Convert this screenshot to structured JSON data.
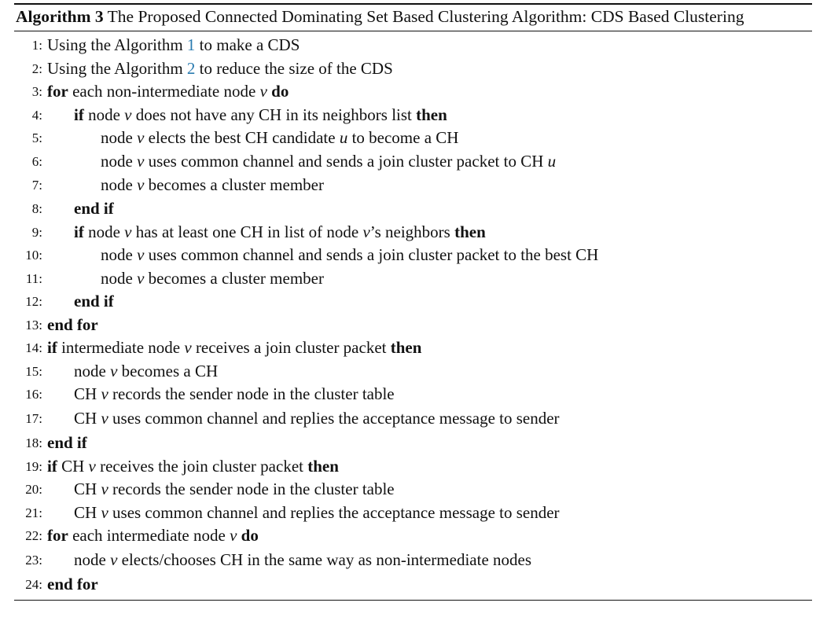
{
  "algorithm": {
    "label": "Algorithm 3",
    "caption": "The Proposed Connected Dominating Set Based Clustering Algorithm: CDS Based Clustering",
    "ref_color": "#2a7bb0",
    "lines": [
      {
        "num": "1:",
        "indent": 0,
        "parts": [
          {
            "t": "Using the Algorithm "
          },
          {
            "t": "1",
            "s": "ref"
          },
          {
            "t": " to make a CDS"
          }
        ]
      },
      {
        "num": "2:",
        "indent": 0,
        "parts": [
          {
            "t": "Using the Algorithm "
          },
          {
            "t": "2",
            "s": "ref"
          },
          {
            "t": " to reduce the size of the CDS"
          }
        ]
      },
      {
        "num": "3:",
        "indent": 0,
        "parts": [
          {
            "t": "for",
            "s": "kw"
          },
          {
            "t": " each non-intermediate node "
          },
          {
            "t": "v",
            "s": "var"
          },
          {
            "t": " "
          },
          {
            "t": "do",
            "s": "kw"
          }
        ]
      },
      {
        "num": "4:",
        "indent": 1,
        "parts": [
          {
            "t": "if",
            "s": "kw"
          },
          {
            "t": " node "
          },
          {
            "t": "v",
            "s": "var"
          },
          {
            "t": " does not have any CH in its neighbors list "
          },
          {
            "t": "then",
            "s": "kw"
          }
        ]
      },
      {
        "num": "5:",
        "indent": 2,
        "parts": [
          {
            "t": "node "
          },
          {
            "t": "v",
            "s": "var"
          },
          {
            "t": " elects the best CH candidate "
          },
          {
            "t": "u",
            "s": "var"
          },
          {
            "t": " to become a CH"
          }
        ]
      },
      {
        "num": "6:",
        "indent": 2,
        "parts": [
          {
            "t": "node "
          },
          {
            "t": "v",
            "s": "var"
          },
          {
            "t": " uses common channel and sends a join cluster packet to CH "
          },
          {
            "t": "u",
            "s": "var"
          }
        ]
      },
      {
        "num": "7:",
        "indent": 2,
        "parts": [
          {
            "t": "node "
          },
          {
            "t": "v",
            "s": "var"
          },
          {
            "t": " becomes a cluster member"
          }
        ]
      },
      {
        "num": "8:",
        "indent": 1,
        "parts": [
          {
            "t": "end if",
            "s": "kw"
          }
        ]
      },
      {
        "num": "9:",
        "indent": 1,
        "parts": [
          {
            "t": "if",
            "s": "kw"
          },
          {
            "t": " node "
          },
          {
            "t": "v",
            "s": "var"
          },
          {
            "t": " has at least one CH in list of node "
          },
          {
            "t": "v",
            "s": "var"
          },
          {
            "t": "’s neighbors "
          },
          {
            "t": "then",
            "s": "kw"
          }
        ]
      },
      {
        "num": "10:",
        "indent": 2,
        "parts": [
          {
            "t": "node "
          },
          {
            "t": "v",
            "s": "var"
          },
          {
            "t": " uses common channel and sends a join cluster packet to the best CH"
          }
        ]
      },
      {
        "num": "11:",
        "indent": 2,
        "parts": [
          {
            "t": "node "
          },
          {
            "t": "v",
            "s": "var"
          },
          {
            "t": " becomes a cluster member"
          }
        ]
      },
      {
        "num": "12:",
        "indent": 1,
        "parts": [
          {
            "t": "end if",
            "s": "kw"
          }
        ]
      },
      {
        "num": "13:",
        "indent": 0,
        "parts": [
          {
            "t": "end for",
            "s": "kw"
          }
        ]
      },
      {
        "num": "14:",
        "indent": 0,
        "parts": [
          {
            "t": "if",
            "s": "kw"
          },
          {
            "t": " intermediate node "
          },
          {
            "t": "v",
            "s": "var"
          },
          {
            "t": " receives a join cluster packet "
          },
          {
            "t": "then",
            "s": "kw"
          }
        ]
      },
      {
        "num": "15:",
        "indent": 1,
        "parts": [
          {
            "t": "node "
          },
          {
            "t": "v",
            "s": "var"
          },
          {
            "t": " becomes a CH"
          }
        ]
      },
      {
        "num": "16:",
        "indent": 1,
        "parts": [
          {
            "t": "CH "
          },
          {
            "t": "v",
            "s": "var"
          },
          {
            "t": " records the sender node in the cluster table"
          }
        ]
      },
      {
        "num": "17:",
        "indent": 1,
        "parts": [
          {
            "t": "CH "
          },
          {
            "t": "v",
            "s": "var"
          },
          {
            "t": " uses common channel and replies the acceptance message to sender"
          }
        ]
      },
      {
        "num": "18:",
        "indent": 0,
        "parts": [
          {
            "t": "end if",
            "s": "kw"
          }
        ]
      },
      {
        "num": "19:",
        "indent": 0,
        "parts": [
          {
            "t": "if",
            "s": "kw"
          },
          {
            "t": " CH "
          },
          {
            "t": "v",
            "s": "var"
          },
          {
            "t": " receives the join cluster packet "
          },
          {
            "t": "then",
            "s": "kw"
          }
        ]
      },
      {
        "num": "20:",
        "indent": 1,
        "parts": [
          {
            "t": "CH "
          },
          {
            "t": "v",
            "s": "var"
          },
          {
            "t": " records the sender node in the cluster table"
          }
        ]
      },
      {
        "num": "21:",
        "indent": 1,
        "parts": [
          {
            "t": "CH "
          },
          {
            "t": "v",
            "s": "var"
          },
          {
            "t": " uses common channel and replies the acceptance message to sender"
          }
        ]
      },
      {
        "num": "22:",
        "indent": 0,
        "parts": [
          {
            "t": "for",
            "s": "kw"
          },
          {
            "t": " each intermediate node "
          },
          {
            "t": "v",
            "s": "var"
          },
          {
            "t": " "
          },
          {
            "t": "do",
            "s": "kw"
          }
        ]
      },
      {
        "num": "23:",
        "indent": 1,
        "parts": [
          {
            "t": "node "
          },
          {
            "t": "v",
            "s": "var"
          },
          {
            "t": " elects/chooses CH in the same way as non-intermediate nodes"
          }
        ]
      },
      {
        "num": "24:",
        "indent": 0,
        "parts": [
          {
            "t": "end for",
            "s": "kw"
          }
        ]
      }
    ]
  }
}
